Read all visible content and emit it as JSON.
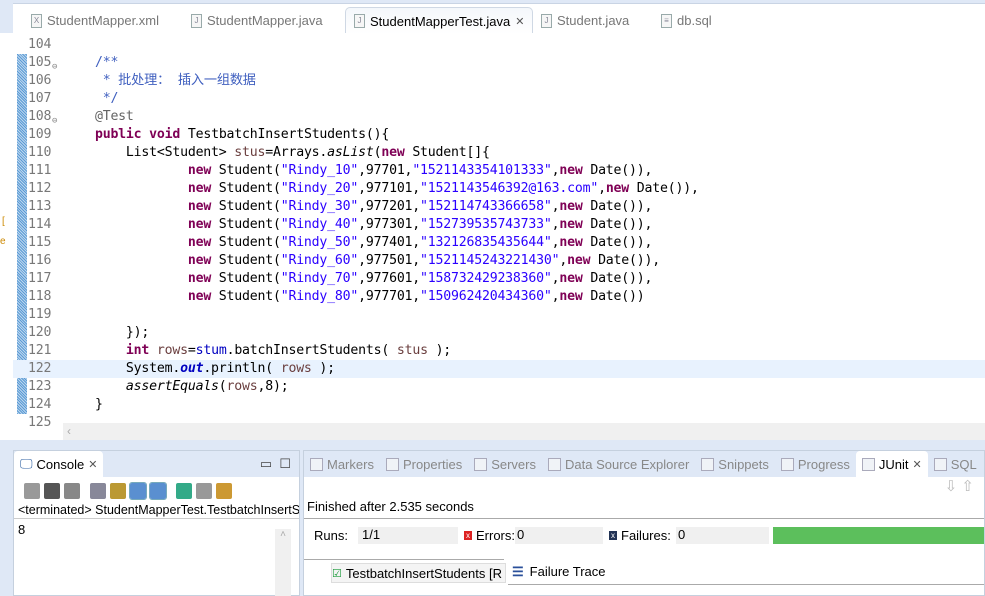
{
  "editor_tabs": [
    {
      "label": "StudentMapper.xml",
      "icon": "xml-file-icon",
      "glyph": "X"
    },
    {
      "label": "StudentMapper.java",
      "icon": "java-file-icon",
      "glyph": "J"
    },
    {
      "label": "StudentMapperTest.java",
      "icon": "java-file-icon",
      "glyph": "J",
      "active": true
    },
    {
      "label": "Student.java",
      "icon": "java-file-icon",
      "glyph": "J"
    },
    {
      "label": "db.sql",
      "icon": "sql-file-icon",
      "glyph": "≡"
    }
  ],
  "editor": {
    "current_line": "122",
    "lines": [
      {
        "n": "104",
        "t": []
      },
      {
        "n": "105",
        "fold": true,
        "t": [
          [
            "p",
            "    "
          ],
          [
            "c",
            "/**"
          ]
        ]
      },
      {
        "n": "106",
        "t": [
          [
            "p",
            "     "
          ],
          [
            "c",
            "* 批处理： 插入一组数据"
          ]
        ]
      },
      {
        "n": "107",
        "t": [
          [
            "p",
            "     "
          ],
          [
            "c",
            "*/"
          ]
        ]
      },
      {
        "n": "108",
        "fold": true,
        "t": [
          [
            "p",
            "    "
          ],
          [
            "a",
            "@Test"
          ]
        ]
      },
      {
        "n": "109",
        "t": [
          [
            "p",
            "    "
          ],
          [
            "k",
            "public"
          ],
          [
            "p",
            " "
          ],
          [
            "k",
            "void"
          ],
          [
            "p",
            " TestbatchInsertStudents(){"
          ]
        ]
      },
      {
        "n": "110",
        "t": [
          [
            "p",
            "        List<Student> "
          ],
          [
            "v",
            "stus"
          ],
          [
            "p",
            "=Arrays."
          ],
          [
            "i",
            "asList"
          ],
          [
            "p",
            "("
          ],
          [
            "k",
            "new"
          ],
          [
            "p",
            " Student[]{"
          ]
        ]
      },
      {
        "n": "111",
        "t": [
          [
            "p",
            "                "
          ],
          [
            "k",
            "new"
          ],
          [
            "p",
            " Student("
          ],
          [
            "s",
            "\"Rindy_10\""
          ],
          [
            "p",
            ",97701,"
          ],
          [
            "s",
            "\"1521143354101333\""
          ],
          [
            "p",
            ","
          ],
          [
            "k",
            "new"
          ],
          [
            "p",
            " Date()),"
          ]
        ]
      },
      {
        "n": "112",
        "t": [
          [
            "p",
            "                "
          ],
          [
            "k",
            "new"
          ],
          [
            "p",
            " Student("
          ],
          [
            "s",
            "\"Rindy_20\""
          ],
          [
            "p",
            ",977101,"
          ],
          [
            "s",
            "\"1521143546392@163.com\""
          ],
          [
            "p",
            ","
          ],
          [
            "k",
            "new"
          ],
          [
            "p",
            " Date()),"
          ]
        ]
      },
      {
        "n": "113",
        "t": [
          [
            "p",
            "                "
          ],
          [
            "k",
            "new"
          ],
          [
            "p",
            " Student("
          ],
          [
            "s",
            "\"Rindy_30\""
          ],
          [
            "p",
            ",977201,"
          ],
          [
            "s",
            "\"152114743366658\""
          ],
          [
            "p",
            ","
          ],
          [
            "k",
            "new"
          ],
          [
            "p",
            " Date()),"
          ]
        ]
      },
      {
        "n": "114",
        "t": [
          [
            "p",
            "                "
          ],
          [
            "k",
            "new"
          ],
          [
            "p",
            " Student("
          ],
          [
            "s",
            "\"Rindy_40\""
          ],
          [
            "p",
            ",977301,"
          ],
          [
            "s",
            "\"152739535743733\""
          ],
          [
            "p",
            ","
          ],
          [
            "k",
            "new"
          ],
          [
            "p",
            " Date()),"
          ]
        ]
      },
      {
        "n": "115",
        "t": [
          [
            "p",
            "                "
          ],
          [
            "k",
            "new"
          ],
          [
            "p",
            " Student("
          ],
          [
            "s",
            "\"Rindy_50\""
          ],
          [
            "p",
            ",977401,"
          ],
          [
            "s",
            "\"132126835435644\""
          ],
          [
            "p",
            ","
          ],
          [
            "k",
            "new"
          ],
          [
            "p",
            " Date()),"
          ]
        ]
      },
      {
        "n": "116",
        "t": [
          [
            "p",
            "                "
          ],
          [
            "k",
            "new"
          ],
          [
            "p",
            " Student("
          ],
          [
            "s",
            "\"Rindy_60\""
          ],
          [
            "p",
            ",977501,"
          ],
          [
            "s",
            "\"1521145243221430\""
          ],
          [
            "p",
            ","
          ],
          [
            "k",
            "new"
          ],
          [
            "p",
            " Date()),"
          ]
        ]
      },
      {
        "n": "117",
        "t": [
          [
            "p",
            "                "
          ],
          [
            "k",
            "new"
          ],
          [
            "p",
            " Student("
          ],
          [
            "s",
            "\"Rindy_70\""
          ],
          [
            "p",
            ",977601,"
          ],
          [
            "s",
            "\"158732429238360\""
          ],
          [
            "p",
            ","
          ],
          [
            "k",
            "new"
          ],
          [
            "p",
            " Date()),"
          ]
        ]
      },
      {
        "n": "118",
        "t": [
          [
            "p",
            "                "
          ],
          [
            "k",
            "new"
          ],
          [
            "p",
            " Student("
          ],
          [
            "s",
            "\"Rindy_80\""
          ],
          [
            "p",
            ",977701,"
          ],
          [
            "s",
            "\"150962420434360\""
          ],
          [
            "p",
            ","
          ],
          [
            "k",
            "new"
          ],
          [
            "p",
            " Date())"
          ]
        ]
      },
      {
        "n": "119",
        "t": []
      },
      {
        "n": "120",
        "t": [
          [
            "p",
            "        });"
          ]
        ]
      },
      {
        "n": "121",
        "t": [
          [
            "p",
            "        "
          ],
          [
            "k",
            "int"
          ],
          [
            "p",
            " "
          ],
          [
            "v",
            "rows"
          ],
          [
            "p",
            "="
          ],
          [
            "fl",
            "stum"
          ],
          [
            "p",
            ".batchInsertStudents( "
          ],
          [
            "v",
            "stus"
          ],
          [
            "p",
            " );"
          ]
        ]
      },
      {
        "n": "122",
        "t": [
          [
            "p",
            "        System."
          ],
          [
            "f",
            "out"
          ],
          [
            "p",
            ".println( "
          ],
          [
            "v",
            "rows"
          ],
          [
            "p",
            " );"
          ]
        ]
      },
      {
        "n": "123",
        "t": [
          [
            "p",
            "        "
          ],
          [
            "i",
            "assertEquals"
          ],
          [
            "p",
            "("
          ],
          [
            "v",
            "rows"
          ],
          [
            "p",
            ",8);"
          ]
        ]
      },
      {
        "n": "124",
        "t": [
          [
            "p",
            "    }"
          ]
        ]
      },
      {
        "n": "125",
        "t": []
      }
    ]
  },
  "console": {
    "tab_label": "Console",
    "status": "<terminated> StudentMapperTest.TestbatchInsertStudents",
    "output": "8",
    "toolbar": [
      "terminate",
      "remove-launch",
      "remove-all",
      "clear",
      "scroll-lock",
      "show-on-stdout",
      "show-on-stderr",
      "pin",
      "display-console",
      "new-console"
    ]
  },
  "junit_panel": {
    "tabs": [
      "Markers",
      "Properties",
      "Servers",
      "Data Source Explorer",
      "Snippets",
      "Progress",
      "JUnit",
      "SQL"
    ],
    "active_tab": "JUnit",
    "finished": "Finished after 2.535 seconds",
    "runs_label": "Runs:",
    "runs": "1/1",
    "errors_label": "Errors:",
    "errors": "0",
    "failures_label": "Failures:",
    "failures": "0",
    "progress": 1.0,
    "progress_color": "#5cbf5c",
    "test_item": "TestbatchInsertStudents [R",
    "failure_trace": "Failure Trace"
  }
}
